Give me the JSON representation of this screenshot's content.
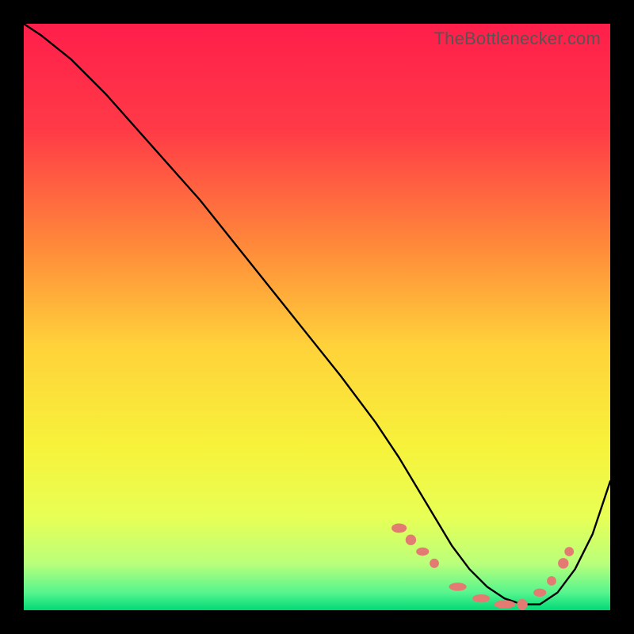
{
  "watermark": "TheBottlenecker.com",
  "chart_data": {
    "type": "line",
    "title": "",
    "xlabel": "",
    "ylabel": "",
    "xlim": [
      0,
      100
    ],
    "ylim": [
      0,
      100
    ],
    "grid": false,
    "legend": false,
    "background_gradient": {
      "stops": [
        {
          "offset": 0.0,
          "color": "#ff1e4b"
        },
        {
          "offset": 0.18,
          "color": "#ff3a47"
        },
        {
          "offset": 0.38,
          "color": "#ff8a3a"
        },
        {
          "offset": 0.55,
          "color": "#ffd23a"
        },
        {
          "offset": 0.72,
          "color": "#f7f23a"
        },
        {
          "offset": 0.84,
          "color": "#e8ff55"
        },
        {
          "offset": 0.92,
          "color": "#baff7a"
        },
        {
          "offset": 0.97,
          "color": "#56f58e"
        },
        {
          "offset": 1.0,
          "color": "#00d977"
        }
      ]
    },
    "series": [
      {
        "name": "curve",
        "color": "#000000",
        "x": [
          0,
          3,
          8,
          14,
          22,
          30,
          38,
          46,
          54,
          60,
          64,
          67,
          70,
          73,
          76,
          79,
          82,
          85,
          88,
          91,
          94,
          97,
          100
        ],
        "y": [
          100,
          98,
          94,
          88,
          79,
          70,
          60,
          50,
          40,
          32,
          26,
          21,
          16,
          11,
          7,
          4,
          2,
          1,
          1,
          3,
          7,
          13,
          22
        ]
      }
    ],
    "markers": {
      "name": "highlight-points",
      "color": "#e37b72",
      "points": [
        {
          "x": 64,
          "y": 14,
          "w": 2.6,
          "h": 1.6
        },
        {
          "x": 66,
          "y": 12,
          "r": 0.9
        },
        {
          "x": 68,
          "y": 10,
          "w": 2.2,
          "h": 1.4
        },
        {
          "x": 70,
          "y": 8,
          "r": 0.8
        },
        {
          "x": 74,
          "y": 4,
          "w": 3.0,
          "h": 1.4
        },
        {
          "x": 78,
          "y": 2,
          "w": 3.0,
          "h": 1.4
        },
        {
          "x": 82,
          "y": 1,
          "w": 3.6,
          "h": 1.4
        },
        {
          "x": 85,
          "y": 1,
          "r": 0.9
        },
        {
          "x": 88,
          "y": 3,
          "w": 2.2,
          "h": 1.4
        },
        {
          "x": 90,
          "y": 5,
          "r": 0.8
        },
        {
          "x": 92,
          "y": 8,
          "r": 0.9
        },
        {
          "x": 93,
          "y": 10,
          "r": 0.8
        }
      ]
    }
  }
}
